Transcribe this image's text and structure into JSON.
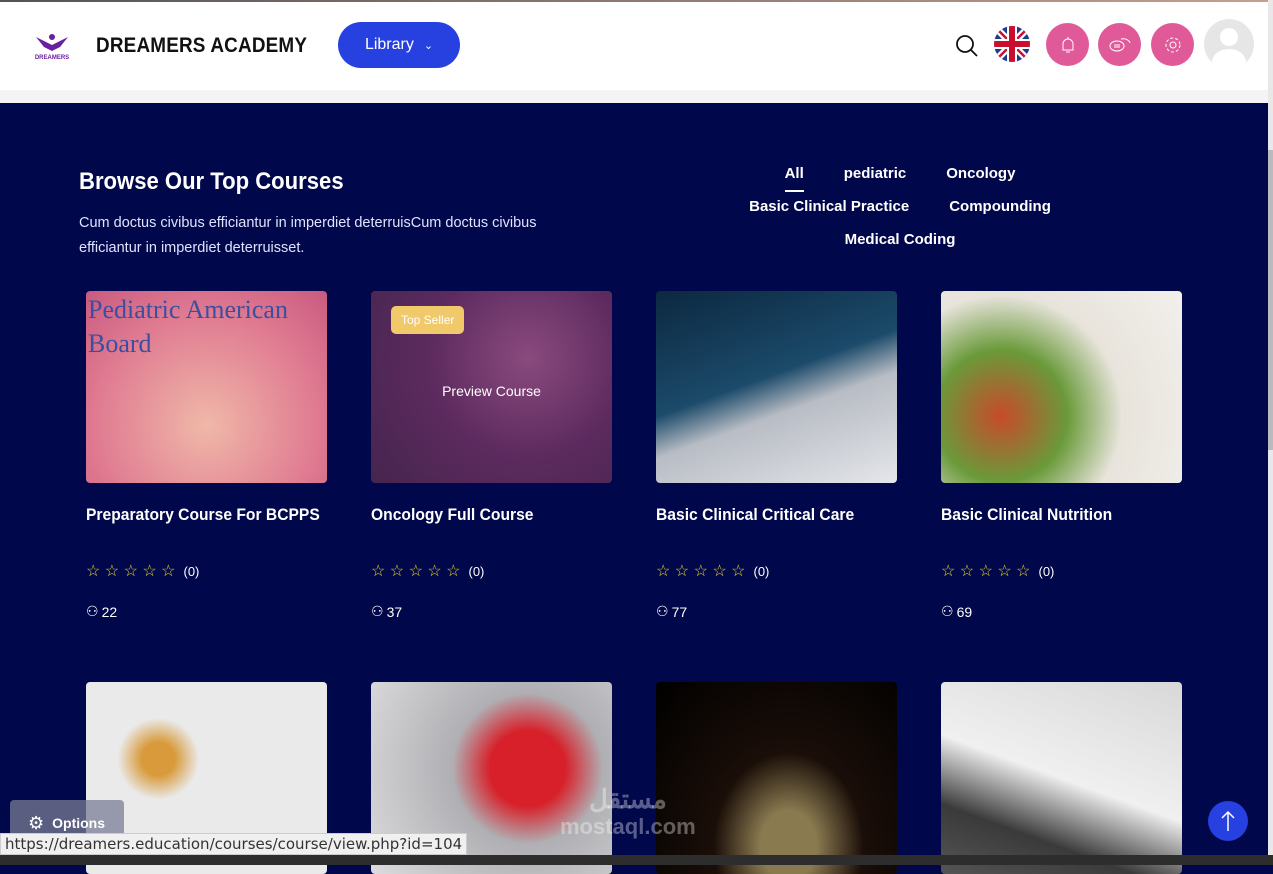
{
  "header": {
    "brand": "DREAMERS ACADEMY",
    "logo_text": "DREAMERS",
    "library_label": "Library"
  },
  "section": {
    "title": "Browse Our Top Courses",
    "description": "Cum doctus civibus efficiantur in imperdiet deterruisCum doctus civibus efficiantur in imperdiet deterruisset."
  },
  "filters": [
    "All",
    "pediatric",
    "Oncology",
    "Basic Clinical Practice",
    "Compounding",
    "Medical Coding"
  ],
  "courses": [
    {
      "title": "Preparatory Course For BCPPS",
      "rating": "(0)",
      "students": "22",
      "image_text": "Pediatric American Board"
    },
    {
      "title": "Oncology Full Course",
      "rating": "(0)",
      "students": "37",
      "badge": "Top Seller",
      "preview": "Preview Course"
    },
    {
      "title": "Basic Clinical Critical Care",
      "rating": "(0)",
      "students": "77"
    },
    {
      "title": "Basic Clinical Nutrition",
      "rating": "(0)",
      "students": "69"
    }
  ],
  "options_label": "Options",
  "status_url": "https://dreamers.education/courses/course/view.php?id=104",
  "watermark": {
    "arabic": "مستقل",
    "latin": "mostaql.com"
  },
  "colors": {
    "background": "#00074a",
    "accent": "#2740e0",
    "pink": "#e05a9a",
    "badge": "#f0c96b"
  }
}
